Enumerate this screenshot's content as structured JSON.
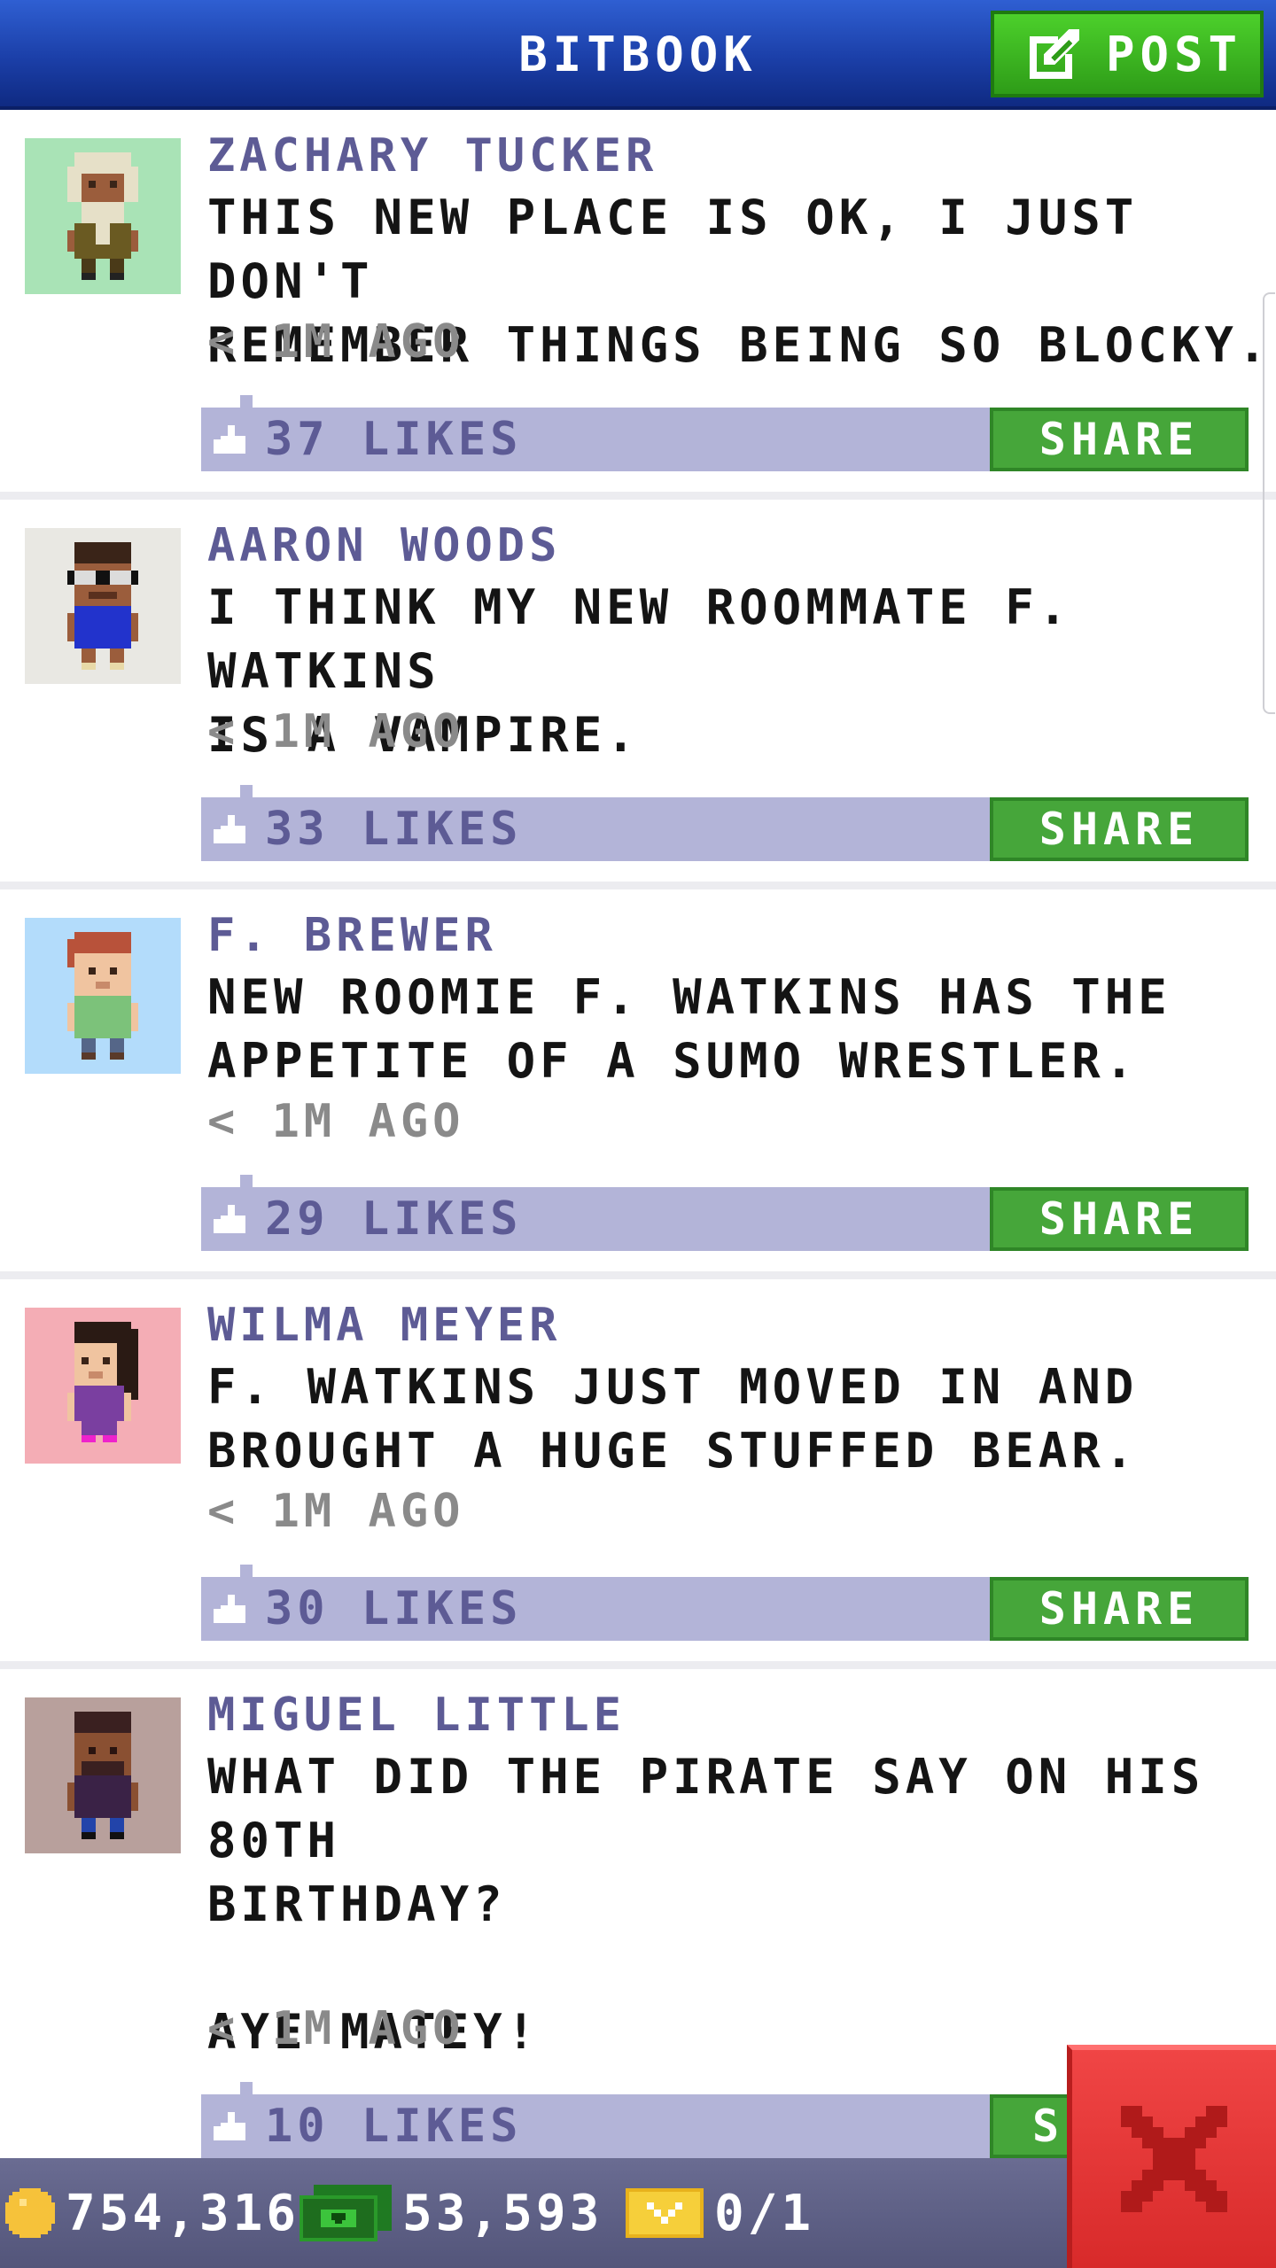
{
  "header": {
    "title": "BITBOOK",
    "post_label": "POST"
  },
  "colors": {
    "header_blue": "#1b3fa8",
    "post_green": "#2e9c18",
    "author_purple": "#5d5b95",
    "likes_bar": "#b3b4d8",
    "share_green": "#46a63a",
    "close_red": "#d82a2a",
    "status_bar": "#5e6086"
  },
  "posts": [
    {
      "author": "ZACHARY TUCKER",
      "text": "THIS NEW PLACE IS OK, I JUST DON'T\nREMEMBER THINGS BEING SO BLOCKY.",
      "time": "< 1M AGO",
      "likes": "37 LIKES",
      "share_label": "SHARE"
    },
    {
      "author": "AARON WOODS",
      "text": "I THINK MY NEW ROOMMATE F. WATKINS\nIS A VAMPIRE.",
      "time": "< 1M AGO",
      "likes": "33 LIKES",
      "share_label": "SHARE"
    },
    {
      "author": "F. BREWER",
      "text": "NEW ROOMIE F. WATKINS HAS THE\nAPPETITE OF A SUMO WRESTLER.",
      "time": "< 1M AGO",
      "likes": "29 LIKES",
      "share_label": "SHARE"
    },
    {
      "author": "WILMA MEYER",
      "text": "F. WATKINS JUST MOVED IN AND\nBROUGHT A HUGE STUFFED BEAR.",
      "time": "< 1M AGO",
      "likes": "30 LIKES",
      "share_label": "SHARE"
    },
    {
      "author": "MIGUEL LITTLE",
      "text": "WHAT DID THE PIRATE SAY ON HIS 80TH\nBIRTHDAY?\n\nAYE MATEY!",
      "time": "< 1M AGO",
      "likes": "10 LIKES",
      "share_label": "SHARE"
    }
  ],
  "status": {
    "coins": "754,316",
    "bux": "53,593",
    "tickets": "0/1",
    "icons": [
      "coin-icon",
      "bux-icon",
      "ticket-icon"
    ]
  },
  "icons": {
    "post": "edit-icon",
    "like": "thumbs-up-icon",
    "close": "close-icon"
  }
}
